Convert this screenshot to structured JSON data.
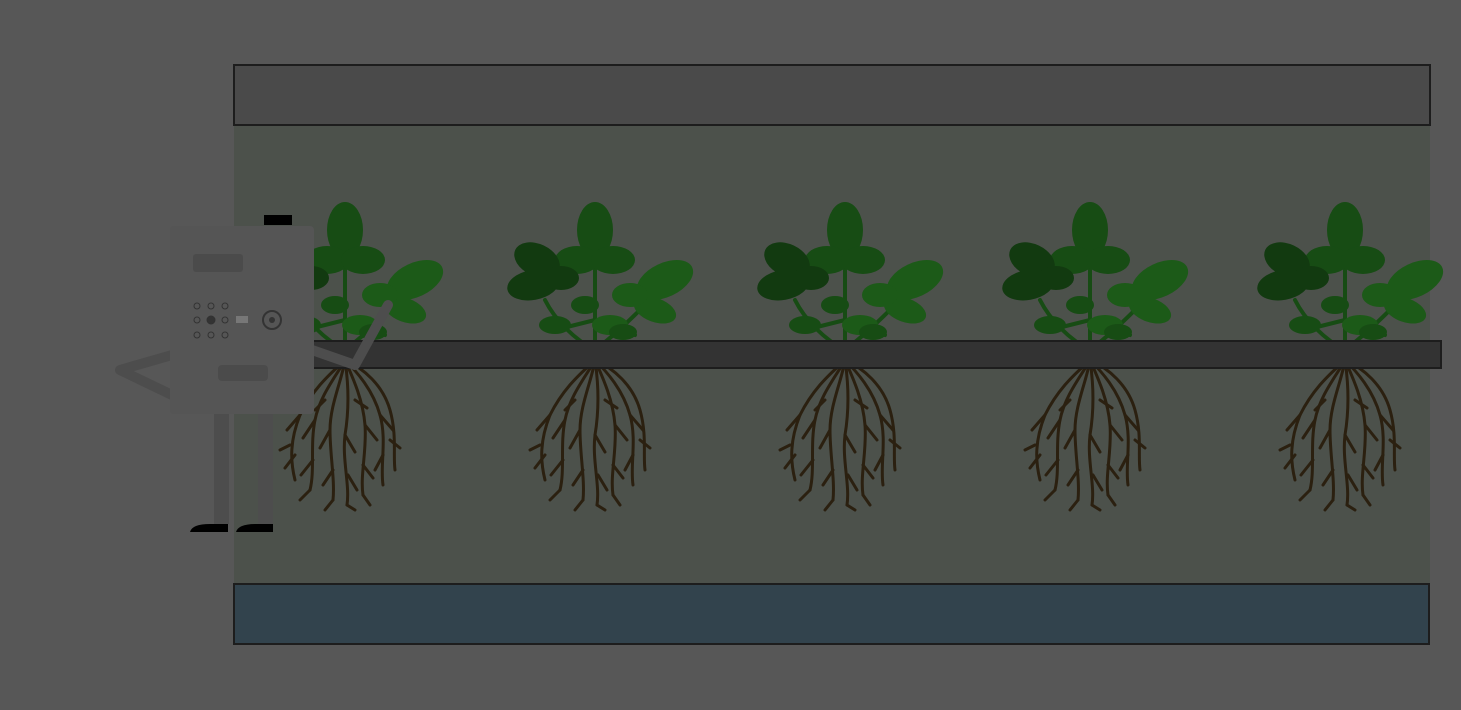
{
  "scene": {
    "colors": {
      "background": "#575757",
      "top_panel": "#4a4a4a",
      "chamber": "#4c514b",
      "reservoir": "#32434d",
      "rail": "#333333",
      "outline": "#1d1d1d",
      "leaf_dark": "#123a10",
      "leaf_mid": "#174c14",
      "leaf_light": "#1c5a18",
      "root": "#2b2010",
      "robot_body": "#555555",
      "robot_detail": "#4b4b4b",
      "robot_foot": "#000000"
    },
    "plants": [
      {
        "id": 1,
        "icon": "seedling-icon"
      },
      {
        "id": 2,
        "icon": "seedling-icon"
      },
      {
        "id": 3,
        "icon": "seedling-icon"
      },
      {
        "id": 4,
        "icon": "seedling-icon"
      },
      {
        "id": 5,
        "icon": "seedling-icon"
      }
    ],
    "robot": {
      "icon": "robot-icon",
      "buttons": 9
    }
  }
}
